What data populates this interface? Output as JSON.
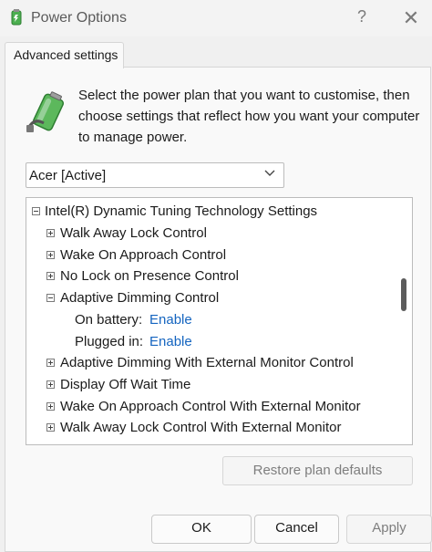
{
  "window": {
    "title": "Power Options",
    "help_glyph": "?",
    "close_glyph": "✕"
  },
  "tabs": [
    {
      "label": "Advanced settings"
    }
  ],
  "description": "Select the power plan that you want to customise, then choose settings that reflect how you want your computer to manage power.",
  "plan_select": {
    "value": "Acer [Active]"
  },
  "tree": {
    "items": [
      {
        "label": "Intel(R) Dynamic Tuning Technology Settings",
        "expanded": true
      },
      {
        "label": "Walk Away Lock Control",
        "expanded": false
      },
      {
        "label": "Wake On Approach Control",
        "expanded": false
      },
      {
        "label": "No Lock on Presence Control",
        "expanded": false
      },
      {
        "label": "Adaptive Dimming Control",
        "expanded": true
      },
      {
        "label": "On battery:",
        "value": "Enable"
      },
      {
        "label": "Plugged in:",
        "value": "Enable"
      },
      {
        "label": "Adaptive Dimming With External Monitor Control",
        "expanded": false
      },
      {
        "label": "Display Off Wait Time",
        "expanded": false
      },
      {
        "label": "Wake On Approach Control With External Monitor",
        "expanded": false
      },
      {
        "label": "Walk Away Lock Control With External Monitor",
        "expanded": false
      }
    ]
  },
  "buttons": {
    "restore": "Restore plan defaults",
    "ok": "OK",
    "cancel": "Cancel",
    "apply": "Apply"
  },
  "colors": {
    "link": "#1565c0",
    "disabled_text": "#7e7e7e",
    "battery_green": "#4caf50"
  }
}
